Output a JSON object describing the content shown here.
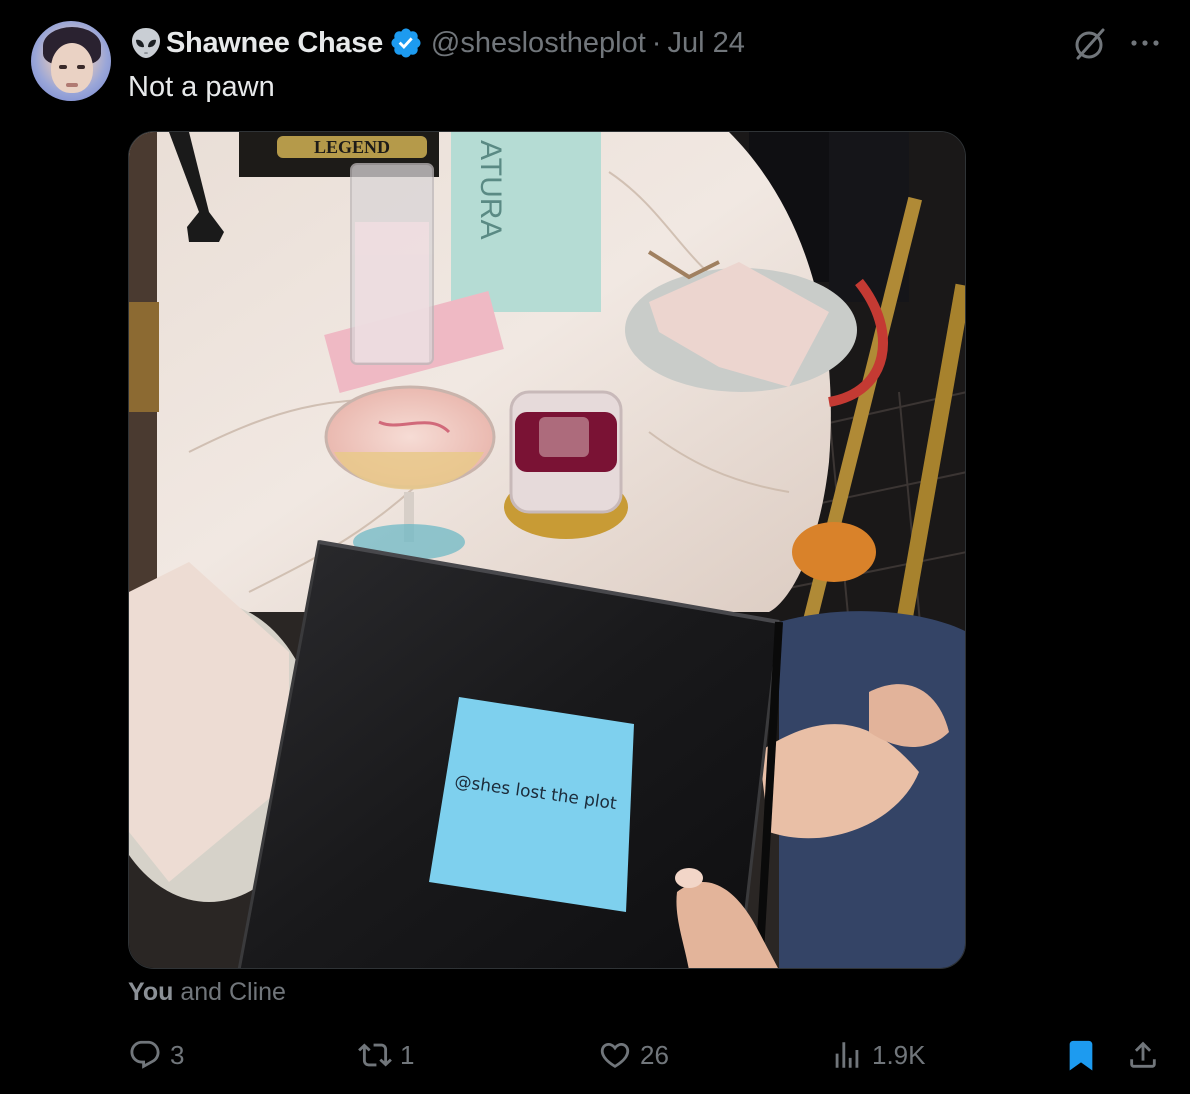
{
  "tweet": {
    "display_name": "Shawnee Chase",
    "handle": "@sheslostheplot",
    "separator": "·",
    "date": "Jul 24",
    "text": "Not a pawn",
    "icons": {
      "name_prefix": "alien-emoji-icon",
      "verified": "verified-badge-icon",
      "grok": "grok-icon",
      "more": "more-options-icon"
    }
  },
  "media": {
    "sticky_note_text": "@shes lost the plot",
    "menu_text": "ATURA",
    "sign_text": "LEGEND"
  },
  "tagged": {
    "you": "You",
    "rest": " and Cline"
  },
  "actions": {
    "replies": "3",
    "reposts": "1",
    "likes": "26",
    "views": "1.9K"
  },
  "colors": {
    "background": "#000000",
    "text_primary": "#e7e9ea",
    "text_secondary": "#71767b",
    "accent": "#1d9bf0",
    "bookmark_active": "#1d9bf0"
  }
}
